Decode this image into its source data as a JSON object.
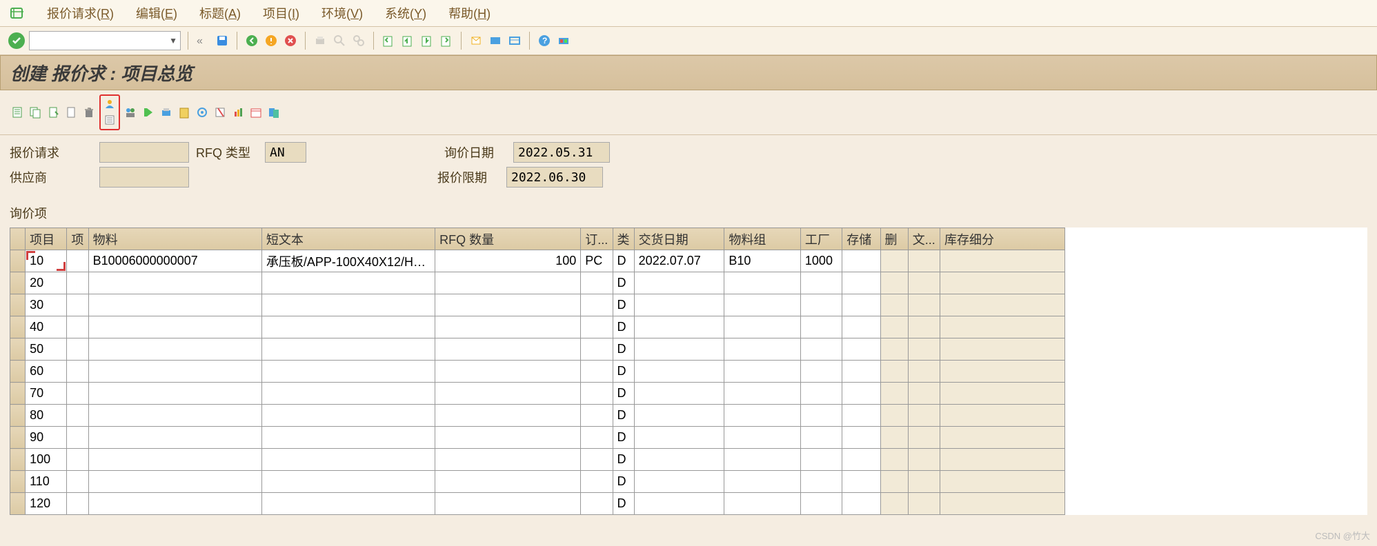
{
  "menu": {
    "items": [
      "报价请求(<u>R</u>)",
      "编辑(<u>E</u>)",
      "标题(<u>A</u>)",
      "项目(<u>I</u>)",
      "环境(<u>V</u>)",
      "系统(<u>Y</u>)",
      "帮助(<u>H</u>)"
    ]
  },
  "title": "创建 报价求 : 项目总览",
  "form": {
    "rfq_request_label": "报价请求",
    "rfq_request_value": "",
    "rfq_type_label": "RFQ 类型",
    "rfq_type_value": "AN",
    "inquiry_date_label": "询价日期",
    "inquiry_date_value": "2022.05.31",
    "supplier_label": "供应商",
    "supplier_value": "",
    "deadline_label": "报价限期",
    "deadline_value": "2022.06.30"
  },
  "section_label": "询价项",
  "columns": {
    "item": "项目",
    "i": "项",
    "material": "物料",
    "short_text": "短文本",
    "rfq_qty": "RFQ 数量",
    "order": "订...",
    "c": "类",
    "deliv_date": "交货日期",
    "matl_group": "物料组",
    "plant": "工厂",
    "storage": "存储",
    "del": "删",
    "text": "文...",
    "stock_seg": "库存细分"
  },
  "rows": [
    {
      "item": "10",
      "material": "B10006000000007",
      "short_text": "承压板/APP-100X40X12/H…",
      "qty": "100",
      "unit": "PC",
      "c": "D",
      "deliv": "2022.07.07",
      "mgrp": "B10",
      "plant": "1000",
      "marker": true
    },
    {
      "item": "20",
      "c": "D"
    },
    {
      "item": "30",
      "c": "D"
    },
    {
      "item": "40",
      "c": "D"
    },
    {
      "item": "50",
      "c": "D"
    },
    {
      "item": "60",
      "c": "D"
    },
    {
      "item": "70",
      "c": "D"
    },
    {
      "item": "80",
      "c": "D"
    },
    {
      "item": "90",
      "c": "D"
    },
    {
      "item": "100",
      "c": "D"
    },
    {
      "item": "110",
      "c": "D"
    },
    {
      "item": "120",
      "c": "D"
    }
  ],
  "watermark": "CSDN @竹大"
}
